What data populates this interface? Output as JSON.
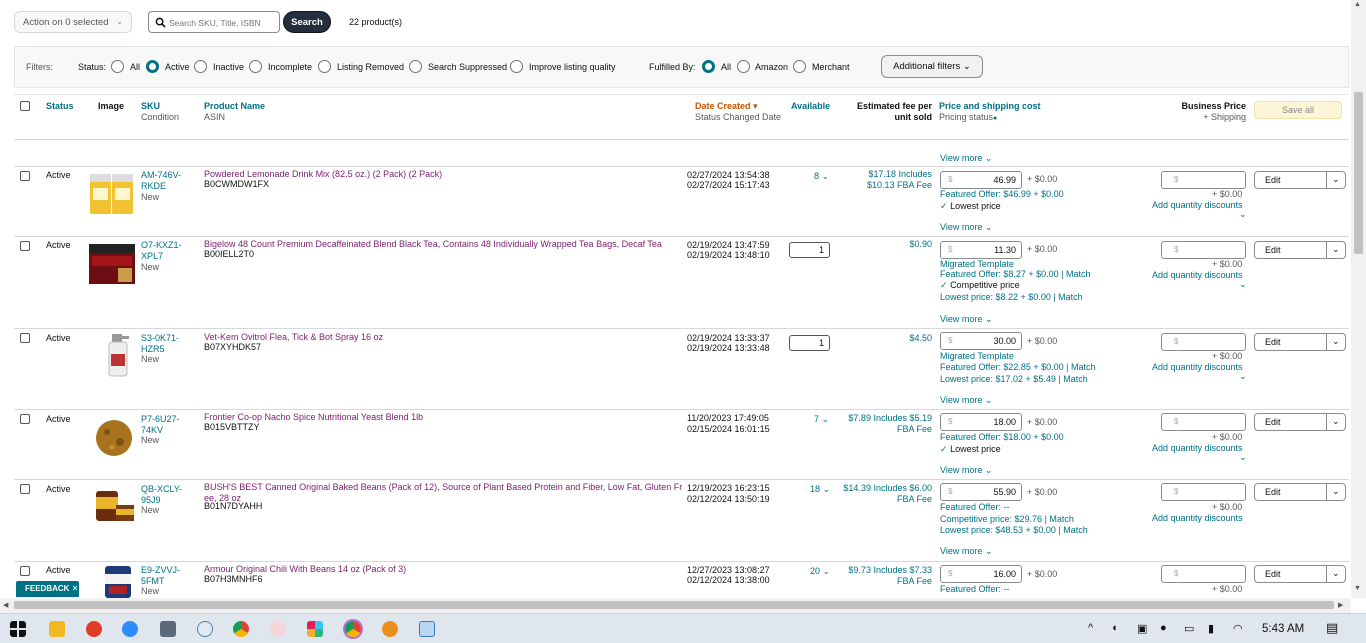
{
  "topbar": {
    "action_select": "Action on 0 selected",
    "search_placeholder": "Search SKU, Title, ISBN",
    "search_button": "Search",
    "product_count": "22 product(s)"
  },
  "filters": {
    "label": "Filters:",
    "status_label": "Status:",
    "status_options": [
      "All",
      "Active",
      "Inactive",
      "Incomplete",
      "Listing Removed",
      "Search Suppressed",
      "Improve listing quality"
    ],
    "status_selected": "Active",
    "fulfilled_label": "Fulfilled By:",
    "fulfilled_options": [
      "All",
      "Amazon",
      "Merchant"
    ],
    "fulfilled_selected": "All",
    "additional_filters": "Additional filters"
  },
  "columns": {
    "status": "Status",
    "image": "Image",
    "sku": "SKU",
    "sku_sub": "Condition",
    "product_name": "Product Name",
    "product_sub": "ASIN",
    "date_created": "Date Created",
    "date_sub": "Status Changed Date",
    "available": "Available",
    "fee": "Estimated fee per",
    "fee_sub": "unit sold",
    "price": "Price and shipping cost",
    "price_sub": "Pricing status",
    "business": "Business Price",
    "business_sub": "+ Shipping",
    "save_all": "Save all"
  },
  "common": {
    "view_more": "View more",
    "shipping": "+ $0.00",
    "dollar": "$",
    "add_qty": "Add quantity discounts",
    "edit": "Edit",
    "migrated": "Migrated Template",
    "match": "Match"
  },
  "rows": [
    {
      "status": "Active",
      "sku1": "AM-746V-",
      "sku2": "RKDE",
      "condition": "New",
      "title": "Powdered Lemonade Drink Mix (82.5 oz.) (2 Pack) (2 Pack)",
      "asin": "B0CWMDW1FX",
      "date1": "02/27/2024 13:54:38",
      "date2": "02/27/2024 15:17:43",
      "available": "8",
      "fee1": "$17.18 Includes",
      "fee2": "$10.13 FBA Fee",
      "price": "46.99",
      "featured": "Featured Offer: $46.99 + $0.00",
      "badge": "Lowest price"
    },
    {
      "status": "Active",
      "sku1": "O7-KXZ1-",
      "sku2": "XPL7",
      "condition": "New",
      "title": "Bigelow 48 Count Premium Decaffeinated Blend Black Tea, Contains 48 Individually Wrapped Tea Bags, Decaf Tea",
      "asin": "B00IELL2T0",
      "date1": "02/19/2024 13:47:59",
      "date2": "02/19/2024 13:48:10",
      "available": "1",
      "fee1": "$0.90",
      "price": "11.30",
      "featured": "Featured Offer: $8.27 + $0.00",
      "badge": "Competitive price",
      "lowest": "Lowest price: $8.22 + $0.00"
    },
    {
      "status": "Active",
      "sku1": "S3-0K71-",
      "sku2": "HZR5",
      "condition": "New",
      "title": "Vet-Kem Ovitrol Flea, Tick & Bot Spray 16 oz",
      "asin": "B07XYHDK57",
      "date1": "02/19/2024 13:33:37",
      "date2": "02/19/2024 13:33:48",
      "available": "1",
      "fee1": "$4.50",
      "price": "30.00",
      "featured": "Featured Offer: $22.85 + $0.00",
      "lowest": "Lowest price: $17.02 + $5.49"
    },
    {
      "status": "Active",
      "sku1": "P7-6U27-",
      "sku2": "74KV",
      "condition": "New",
      "title": "Frontier Co-op Nacho Spice Nutritional Yeast Blend 1lb",
      "asin": "B015VBTTZY",
      "date1": "11/20/2023 17:49:05",
      "date2": "02/15/2024 16:01:15",
      "available": "7",
      "fee1": "$7.89 Includes $5.19",
      "fee2": "FBA Fee",
      "price": "18.00",
      "featured": "Featured Offer: $18.00 + $0.00",
      "badge": "Lowest price"
    },
    {
      "status": "Active",
      "sku1": "QB-XCLY-",
      "sku2": "95J9",
      "condition": "New",
      "title1": "BUSH'S BEST Canned Original Baked Beans (Pack of 12), Source of Plant Based Protein and Fiber, Low Fat, Gluten Fr",
      "title2": "ee, 28 oz",
      "asin": "B01N7DYAHH",
      "date1": "12/19/2023 16:23:15",
      "date2": "02/12/2024 13:50:19",
      "available": "18",
      "fee1": "$14.39 Includes $6.00",
      "fee2": "FBA Fee",
      "price": "55.90",
      "featured": "Featured Offer: --",
      "competitive": "Competitive price: $29.76",
      "lowest": "Lowest price: $48.53 + $0.00"
    },
    {
      "status": "Active",
      "sku1": "E9-ZVVJ-",
      "sku2": "5FMT",
      "condition": "New",
      "title": "Armour Original Chili With Beans 14 oz (Pack of 3)",
      "asin": "B07H3MNHF6",
      "date1": "12/27/2023 13:08:27",
      "date2": "02/12/2024 13:38:00",
      "available": "20",
      "fee1": "$9.73 Includes $7.33",
      "fee2": "FBA Fee",
      "price": "16.00",
      "featured": "Featured Offer: --"
    }
  ],
  "feedback": "FEEDBACK",
  "taskbar": {
    "time": "5:43 AM"
  }
}
